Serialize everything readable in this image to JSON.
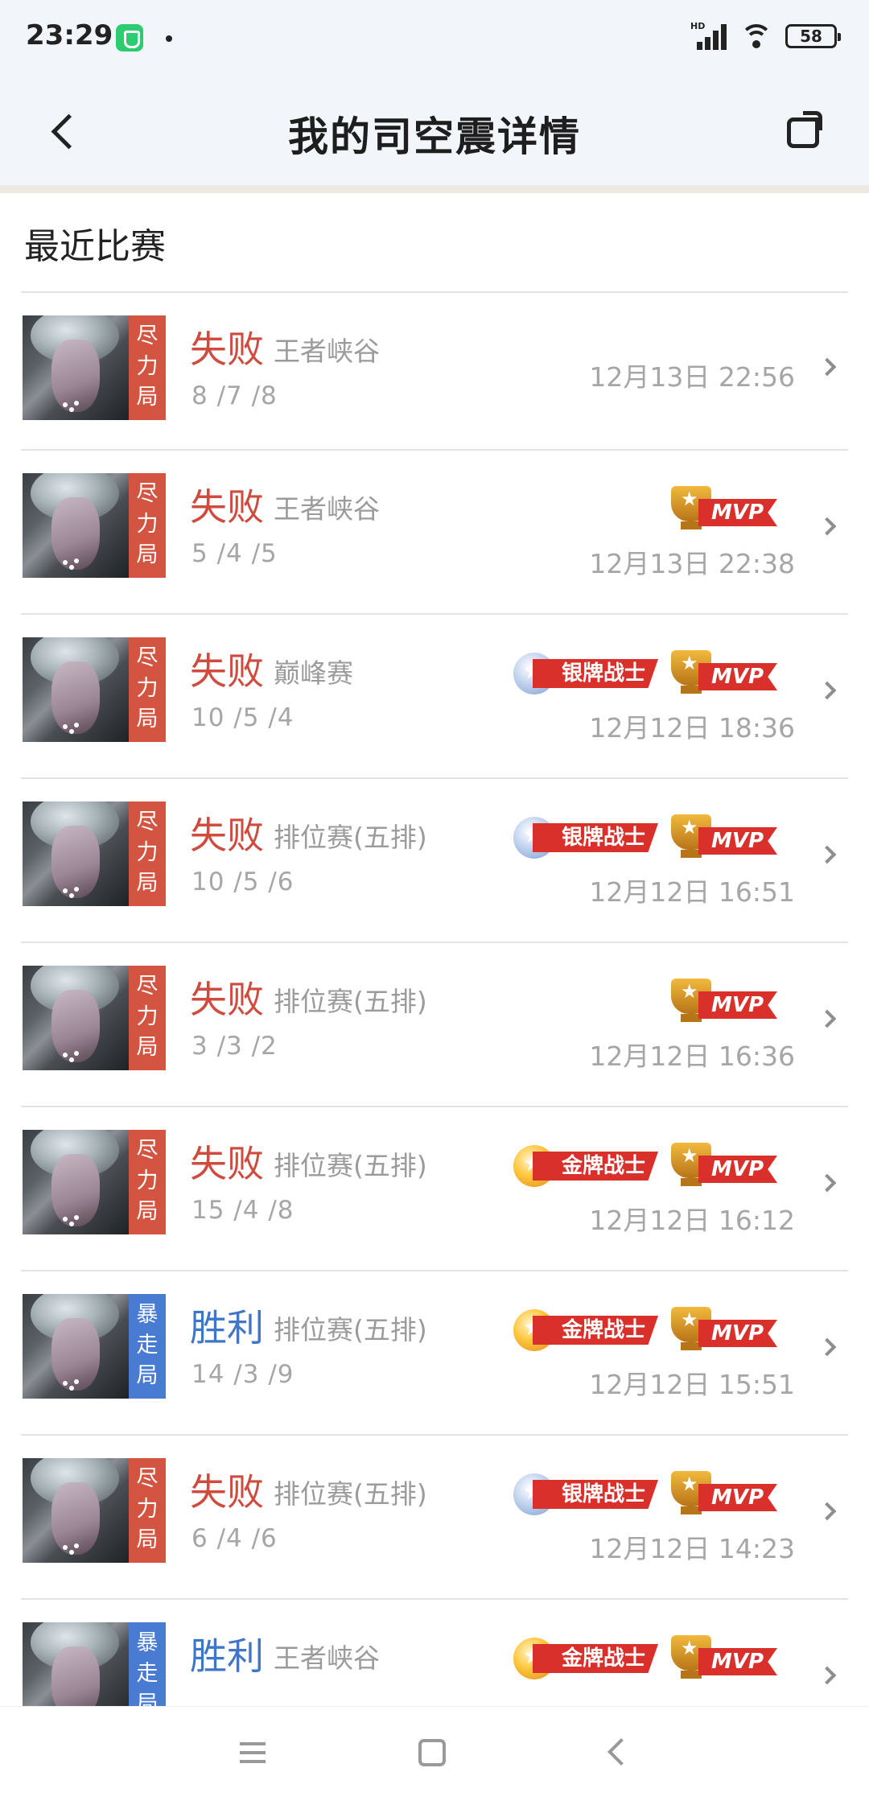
{
  "status_bar": {
    "time": "23:29",
    "network_label": "HD",
    "battery": "58"
  },
  "header": {
    "title": "我的司空震详情"
  },
  "section": {
    "title": "最近比赛"
  },
  "colors": {
    "lose": "#cf4b3e",
    "win": "#3f76c8",
    "tag_lose": "#d35440",
    "tag_win": "#4a7bd2"
  },
  "badge_labels": {
    "silver": "银牌战士",
    "gold": "金牌战士",
    "mvp": "MVP"
  },
  "matches": [
    {
      "tag": "尽力局",
      "tag_type": "red",
      "result": "失败",
      "result_type": "lose",
      "mode": "王者峡谷",
      "kda": "8 /7 /8",
      "time": "12月13日 22:56",
      "medal": "",
      "mvp": false
    },
    {
      "tag": "尽力局",
      "tag_type": "red",
      "result": "失败",
      "result_type": "lose",
      "mode": "王者峡谷",
      "kda": "5 /4 /5",
      "time": "12月13日 22:38",
      "medal": "",
      "mvp": true
    },
    {
      "tag": "尽力局",
      "tag_type": "red",
      "result": "失败",
      "result_type": "lose",
      "mode": "巅峰赛",
      "kda": "10 /5 /4",
      "time": "12月12日 18:36",
      "medal": "silver",
      "mvp": true
    },
    {
      "tag": "尽力局",
      "tag_type": "red",
      "result": "失败",
      "result_type": "lose",
      "mode": "排位赛(五排)",
      "kda": "10 /5 /6",
      "time": "12月12日 16:51",
      "medal": "silver",
      "mvp": true
    },
    {
      "tag": "尽力局",
      "tag_type": "red",
      "result": "失败",
      "result_type": "lose",
      "mode": "排位赛(五排)",
      "kda": "3 /3 /2",
      "time": "12月12日 16:36",
      "medal": "",
      "mvp": true
    },
    {
      "tag": "尽力局",
      "tag_type": "red",
      "result": "失败",
      "result_type": "lose",
      "mode": "排位赛(五排)",
      "kda": "15 /4 /8",
      "time": "12月12日 16:12",
      "medal": "gold",
      "mvp": true
    },
    {
      "tag": "暴走局",
      "tag_type": "blue",
      "result": "胜利",
      "result_type": "win",
      "mode": "排位赛(五排)",
      "kda": "14 /3 /9",
      "time": "12月12日 15:51",
      "medal": "gold",
      "mvp": true
    },
    {
      "tag": "尽力局",
      "tag_type": "red",
      "result": "失败",
      "result_type": "lose",
      "mode": "排位赛(五排)",
      "kda": "6 /4 /6",
      "time": "12月12日 14:23",
      "medal": "silver",
      "mvp": true
    },
    {
      "tag": "暴走局",
      "tag_type": "blue",
      "result": "胜利",
      "result_type": "win",
      "mode": "王者峡谷",
      "kda": "",
      "time": "",
      "medal": "gold",
      "mvp": true
    }
  ]
}
